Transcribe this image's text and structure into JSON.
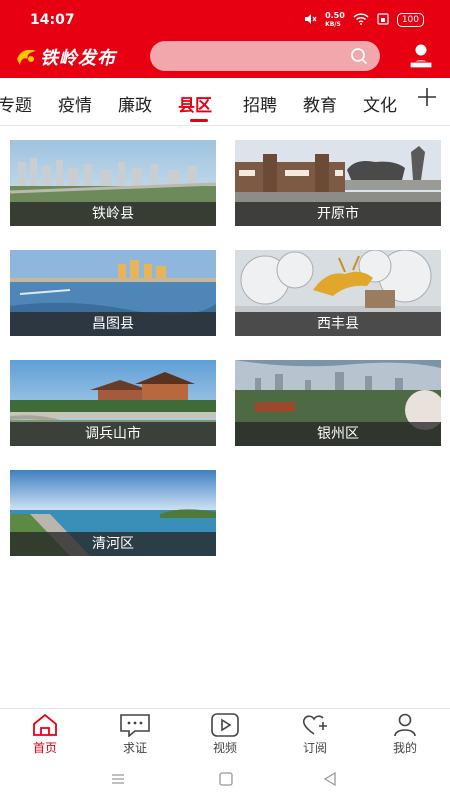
{
  "status": {
    "time": "14:07",
    "speed": "0.50",
    "speed_unit": "KB/S",
    "battery": "100"
  },
  "app": {
    "title": "铁岭发布"
  },
  "tabs": {
    "items": [
      "专题",
      "疫情",
      "廉政",
      "县区",
      "招聘",
      "教育",
      "文化"
    ],
    "active": "县区",
    "add_icon": "plus-icon"
  },
  "counties": [
    {
      "name": "铁岭县"
    },
    {
      "name": "开原市"
    },
    {
      "name": "昌图县"
    },
    {
      "name": "西丰县"
    },
    {
      "name": "调兵山市"
    },
    {
      "name": "银州区"
    },
    {
      "name": "清河区"
    }
  ],
  "bottom_nav": [
    {
      "label": "首页",
      "icon": "home-icon",
      "active": true
    },
    {
      "label": "求证",
      "icon": "message-icon"
    },
    {
      "label": "视频",
      "icon": "play-icon"
    },
    {
      "label": "订阅",
      "icon": "heart-plus-icon"
    },
    {
      "label": "我的",
      "icon": "user-icon"
    }
  ],
  "colors": {
    "brand": "#e60012"
  }
}
